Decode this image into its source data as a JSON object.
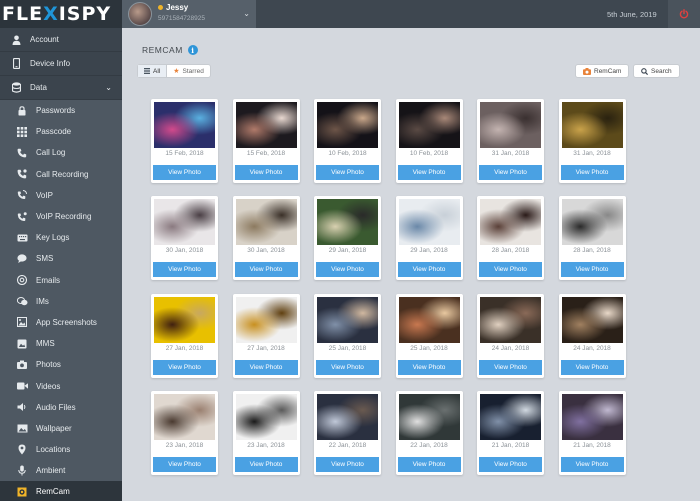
{
  "brand": {
    "logo_left": "FLE",
    "logo_x": "X",
    "logo_right": "ISPY"
  },
  "user": {
    "name": "Jessy",
    "phone": "5971584728925"
  },
  "header": {
    "date": "5th June, 2019"
  },
  "sidebar": {
    "main": [
      {
        "label": "Account",
        "icon": "user-icon"
      },
      {
        "label": "Device Info",
        "icon": "phone-icon"
      },
      {
        "label": "Data",
        "icon": "database-icon"
      }
    ],
    "items": [
      {
        "label": "Passwords",
        "icon": "lock-icon"
      },
      {
        "label": "Passcode",
        "icon": "keypad-icon"
      },
      {
        "label": "Call Log",
        "icon": "phone-call-icon"
      },
      {
        "label": "Call Recording",
        "icon": "call-recording-icon"
      },
      {
        "label": "VoIP",
        "icon": "voip-icon"
      },
      {
        "label": "VoIP Recording",
        "icon": "voip-recording-icon"
      },
      {
        "label": "Key Logs",
        "icon": "keyboard-icon"
      },
      {
        "label": "SMS",
        "icon": "sms-icon"
      },
      {
        "label": "Emails",
        "icon": "email-icon"
      },
      {
        "label": "IMs",
        "icon": "chat-icon"
      },
      {
        "label": "App Screenshots",
        "icon": "screenshot-icon"
      },
      {
        "label": "MMS",
        "icon": "mms-icon"
      },
      {
        "label": "Photos",
        "icon": "camera-icon"
      },
      {
        "label": "Videos",
        "icon": "video-icon"
      },
      {
        "label": "Audio Files",
        "icon": "audio-icon"
      },
      {
        "label": "Wallpaper",
        "icon": "image-icon"
      },
      {
        "label": "Locations",
        "icon": "location-icon"
      },
      {
        "label": "Ambient",
        "icon": "microphone-icon"
      },
      {
        "label": "RemCam",
        "icon": "remcam-icon"
      }
    ]
  },
  "page": {
    "title": "REMCAM",
    "filter_all": "All",
    "filter_starred": "Starred",
    "remcam_button": "RemCam",
    "search_button": "Search",
    "view_label": "View Photo"
  },
  "photos": [
    {
      "date": "15 Feb, 2018",
      "colors": [
        "#2b2f6b",
        "#d24a8c",
        "#5ab0e0"
      ]
    },
    {
      "date": "15 Feb, 2018",
      "colors": [
        "#1d1a1f",
        "#b07a6a",
        "#e8d8d0"
      ]
    },
    {
      "date": "10 Feb, 2018",
      "colors": [
        "#141218",
        "#6d5548",
        "#c9a78a"
      ]
    },
    {
      "date": "10 Feb, 2018",
      "colors": [
        "#151317",
        "#5a4a44",
        "#a88878"
      ]
    },
    {
      "date": "31 Jan, 2018",
      "colors": [
        "#6c6060",
        "#c3b3b0",
        "#3a3030"
      ]
    },
    {
      "date": "31 Jan, 2018",
      "colors": [
        "#5c4a1a",
        "#c9a24a",
        "#2a2210"
      ]
    },
    {
      "date": "30 Jan, 2018",
      "colors": [
        "#e9e6e8",
        "#8a7a80",
        "#4a3f45"
      ]
    },
    {
      "date": "30 Jan, 2018",
      "colors": [
        "#d8d2c8",
        "#8c7a60",
        "#3a3028"
      ]
    },
    {
      "date": "29 Jan, 2018",
      "colors": [
        "#3a5a30",
        "#d8d0b0",
        "#2a2a2a"
      ]
    },
    {
      "date": "29 Jan, 2018",
      "colors": [
        "#e8ecf0",
        "#6a88a8",
        "#c8d0d8"
      ]
    },
    {
      "date": "28 Jan, 2018",
      "colors": [
        "#e8e4e0",
        "#5a4038",
        "#2a1a18"
      ]
    },
    {
      "date": "28 Jan, 2018",
      "colors": [
        "#d8d8d8",
        "#2a2a2a",
        "#888888"
      ]
    },
    {
      "date": "27 Jan, 2018",
      "colors": [
        "#e8c000",
        "#402010",
        "#c8a860"
      ]
    },
    {
      "date": "27 Jan, 2018",
      "colors": [
        "#f0f0f0",
        "#c89020",
        "#604010"
      ]
    },
    {
      "date": "25 Jan, 2018",
      "colors": [
        "#2a3040",
        "#8090a8",
        "#d0b8a0"
      ]
    },
    {
      "date": "25 Jan, 2018",
      "colors": [
        "#4a3020",
        "#c87850",
        "#e8c8a0"
      ]
    },
    {
      "date": "24 Jan, 2018",
      "colors": [
        "#3a3028",
        "#e0d0c0",
        "#8a6a58"
      ]
    },
    {
      "date": "24 Jan, 2018",
      "colors": [
        "#2a2018",
        "#a08060",
        "#e8d8c8"
      ]
    },
    {
      "date": "23 Jan, 2018",
      "colors": [
        "#e0d8d0",
        "#4a3a30",
        "#9a8070"
      ]
    },
    {
      "date": "23 Jan, 2018",
      "colors": [
        "#f0f0f0",
        "#1a1a1a",
        "#5a5a5a"
      ]
    },
    {
      "date": "22 Jan, 2018",
      "colors": [
        "#2a3040",
        "#c0c8d8",
        "#6a5a50"
      ]
    },
    {
      "date": "22 Jan, 2018",
      "colors": [
        "#303838",
        "#e0e0e0",
        "#6a7070"
      ]
    },
    {
      "date": "21 Jan, 2018",
      "colors": [
        "#182030",
        "#8090a8",
        "#d0d8e0"
      ]
    },
    {
      "date": "21 Jan, 2018",
      "colors": [
        "#3a3040",
        "#8070a0",
        "#c0b8d0"
      ]
    }
  ],
  "colors": {
    "accent": "#4aa1e3",
    "sidebar": "#3b444d",
    "sidebar_sub": "#4e5862",
    "active": "#2d353c",
    "power": "#e04040"
  }
}
